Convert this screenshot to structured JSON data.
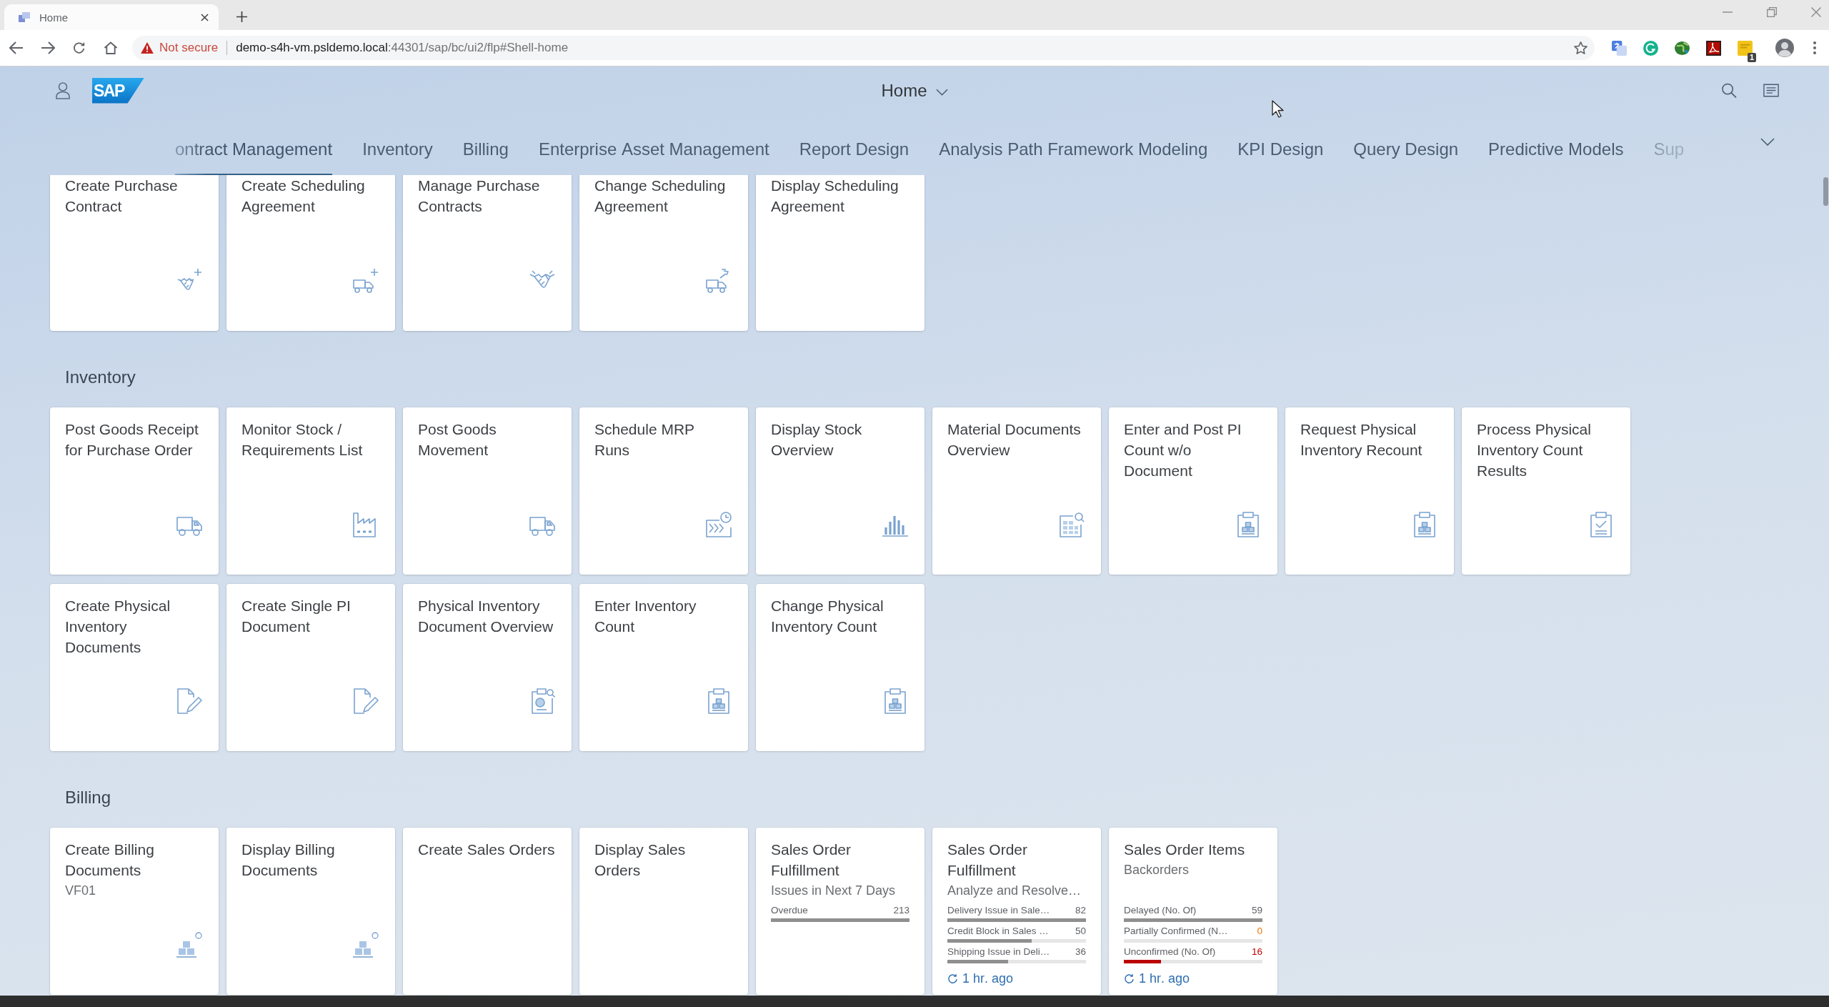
{
  "browser": {
    "tab_title": "Home",
    "security_label": "Not secure",
    "url_host": "demo-s4h-vm.psldemo.local",
    "url_path": ":44301/sap/bc/ui2/flp#Shell-home",
    "extension_badge": "1"
  },
  "shell": {
    "logo_text": "SAP",
    "title": "Home"
  },
  "tabs": [
    {
      "label": "ontract Management",
      "selected": true
    },
    {
      "label": "Inventory",
      "selected": false
    },
    {
      "label": "Billing",
      "selected": false
    },
    {
      "label": "Enterprise Asset Management",
      "selected": false
    },
    {
      "label": "Report Design",
      "selected": false
    },
    {
      "label": "Analysis Path Framework Modeling",
      "selected": false
    },
    {
      "label": "KPI Design",
      "selected": false
    },
    {
      "label": "Query Design",
      "selected": false
    },
    {
      "label": "Predictive Models",
      "selected": false
    },
    {
      "label": "Sup",
      "selected": false
    }
  ],
  "sections": [
    {
      "tiles": [
        {
          "kind": "launch",
          "title": "Create Purchase Contract"
        },
        {
          "kind": "launch",
          "title": "Create Scheduling Agreement"
        },
        {
          "kind": "launch",
          "title": "Manage Purchase Contracts"
        },
        {
          "kind": "launch",
          "title": "Change Scheduling Agreement"
        },
        {
          "kind": "launch",
          "title": "Display Scheduling Agreement"
        }
      ]
    },
    {
      "title": "Inventory",
      "tiles": [
        {
          "kind": "launch",
          "title": "Post Goods Receipt for Purchase Order"
        },
        {
          "kind": "launch",
          "title": "Monitor Stock / Requirements List"
        },
        {
          "kind": "launch",
          "title": "Post Goods Movement"
        },
        {
          "kind": "launch",
          "title": "Schedule MRP Runs"
        },
        {
          "kind": "launch",
          "title": "Display Stock Overview"
        },
        {
          "kind": "launch",
          "title": "Material Documents Overview"
        },
        {
          "kind": "launch",
          "title": "Enter and Post PI Count w/o Document"
        },
        {
          "kind": "launch",
          "title": "Request Physical Inventory Recount"
        },
        {
          "kind": "launch",
          "title": "Process Physical Inventory Count Results"
        },
        {
          "kind": "launch",
          "title": "Create Physical Inventory Documents"
        },
        {
          "kind": "launch",
          "title": "Create Single PI Document"
        },
        {
          "kind": "launch",
          "title": "Physical Inventory Document Overview"
        },
        {
          "kind": "launch",
          "title": "Enter Inventory Count"
        },
        {
          "kind": "launch",
          "title": "Change Physical Inventory Count"
        }
      ]
    },
    {
      "title": "Billing",
      "tiles": [
        {
          "kind": "launch",
          "title": "Create Billing Documents",
          "subtitle": "VF01"
        },
        {
          "kind": "launch",
          "title": "Display Billing Documents"
        },
        {
          "kind": "launch",
          "title": "Create Sales Orders"
        },
        {
          "kind": "launch",
          "title": "Display Sales Orders"
        },
        {
          "kind": "kpi",
          "title": "Sales Order Fulfillment",
          "subtitle": "Issues in Next 7 Days",
          "rows": [
            {
              "label": "Overdue",
              "value": "213",
              "kind": "neutral",
              "level": 1
            }
          ]
        },
        {
          "kind": "kpi",
          "title": "Sales Order Fulfillment",
          "subtitle": "Analyze and Resolve…",
          "rows": [
            {
              "label": "Delivery Issue in Sale…",
              "value": "82",
              "kind": "neutral",
              "level": 1
            },
            {
              "label": "Credit Block in Sales …",
              "value": "50",
              "kind": "neutral",
              "level": 0.61
            },
            {
              "label": "Shipping Issue in Deli…",
              "value": "36",
              "kind": "neutral",
              "level": 0.44
            }
          ],
          "refreshed": "1 hr. ago"
        },
        {
          "kind": "kpi",
          "title": "Sales Order Items",
          "subtitle": "Backorders",
          "rows": [
            {
              "label": "Delayed (No. Of)",
              "value": "59",
              "kind": "neutral",
              "level": 1
            },
            {
              "label": "Partially Confirmed (N…",
              "value": "0",
              "kind": "warning",
              "level": 0
            },
            {
              "label": "Unconfirmed (No. Of)",
              "value": "16",
              "kind": "error",
              "level": 0.27
            }
          ],
          "refreshed": "1 hr. ago"
        }
      ]
    }
  ]
}
